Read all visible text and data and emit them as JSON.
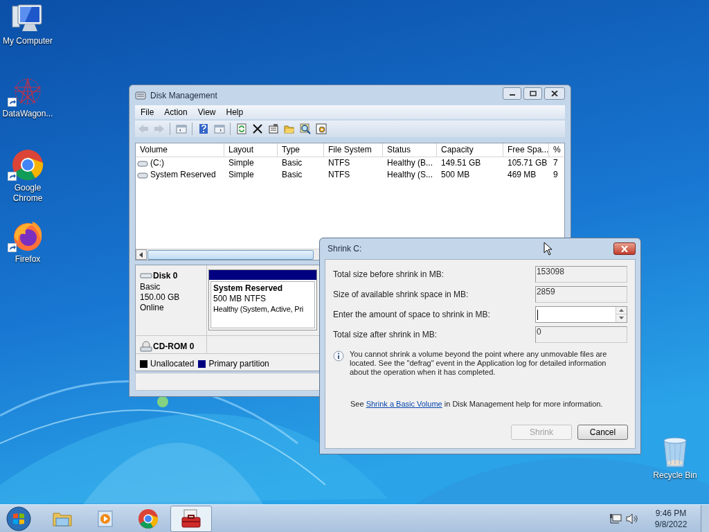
{
  "desktop_icons": [
    {
      "label": "My Computer",
      "kind": "computer",
      "shortcut": false
    },
    {
      "label": "DataWagon...",
      "kind": "web",
      "shortcut": true
    },
    {
      "label": "Google Chrome",
      "kind": "chrome",
      "shortcut": true
    },
    {
      "label": "Firefox",
      "kind": "firefox",
      "shortcut": true
    },
    {
      "label": "Recycle Bin",
      "kind": "bin",
      "shortcut": false
    }
  ],
  "disk_management": {
    "title": "Disk Management",
    "menu": [
      "File",
      "Action",
      "View",
      "Help"
    ],
    "toolbar": [
      {
        "kind": "back",
        "disabled": true
      },
      {
        "kind": "forward",
        "disabled": true
      },
      {
        "kind": "sep"
      },
      {
        "kind": "pane",
        "disabled": false
      },
      {
        "kind": "sep"
      },
      {
        "kind": "help",
        "disabled": false
      },
      {
        "kind": "pane2",
        "disabled": false
      },
      {
        "kind": "sep"
      },
      {
        "kind": "refresh",
        "disabled": false
      },
      {
        "kind": "delete",
        "disabled": false
      },
      {
        "kind": "properties",
        "disabled": false
      },
      {
        "kind": "open",
        "disabled": false
      },
      {
        "kind": "search",
        "disabled": false
      },
      {
        "kind": "settings",
        "disabled": false
      }
    ],
    "table": {
      "columns": [
        "Volume",
        "Layout",
        "Type",
        "File System",
        "Status",
        "Capacity",
        "Free Spa...",
        "%"
      ],
      "rows": [
        {
          "cells": [
            "(C:)",
            "Simple",
            "Basic",
            "NTFS",
            "Healthy (B...",
            "149.51 GB",
            "105.71 GB",
            "7"
          ]
        },
        {
          "cells": [
            "System Reserved",
            "Simple",
            "Basic",
            "NTFS",
            "Healthy (S...",
            "500 MB",
            "469 MB",
            "9"
          ]
        }
      ]
    },
    "disks": [
      {
        "kind": "disk",
        "name": "Disk 0",
        "info": [
          "Basic",
          "150.00 GB",
          "Online"
        ],
        "partition": {
          "name": "System Reserved",
          "size": "500 MB NTFS",
          "status": "Healthy (System, Active, Pri",
          "color": "#000080"
        }
      },
      {
        "kind": "cdrom",
        "name": "CD-ROM 0"
      }
    ],
    "legend": [
      {
        "label": "Unallocated",
        "color": "#000000"
      },
      {
        "label": "Primary partition",
        "color": "#000080"
      }
    ]
  },
  "shrink_dialog": {
    "title": "Shrink C:",
    "fields": [
      {
        "label": "Total size before shrink in MB:",
        "kind": "readonly",
        "value": "153098"
      },
      {
        "label": "Size of available shrink space in MB:",
        "kind": "readonly",
        "value": "2859"
      },
      {
        "label": "Enter the amount of space to shrink in MB:",
        "kind": "spin"
      },
      {
        "label": "Total size after shrink in MB:",
        "kind": "readonly",
        "value": "0"
      }
    ],
    "info": "You cannot shrink a volume beyond the point where any unmovable files are located. See the \"defrag\" event in the Application log for detailed information about the operation when it has completed.",
    "help": {
      "before": "See ",
      "link": "Shrink a Basic Volume",
      "after": " in Disk Management help for more information."
    },
    "buttons": [
      {
        "label": "Shrink",
        "disabled": true
      },
      {
        "label": "Cancel",
        "disabled": false
      }
    ]
  },
  "taskbar": {
    "apps": [
      {
        "kind": "explorer",
        "selected": false
      },
      {
        "kind": "media",
        "selected": false
      },
      {
        "kind": "chrome",
        "selected": false
      },
      {
        "kind": "toolbox",
        "selected": true
      }
    ],
    "clock": {
      "time": "9:46 PM",
      "date": "9/8/2022"
    }
  }
}
